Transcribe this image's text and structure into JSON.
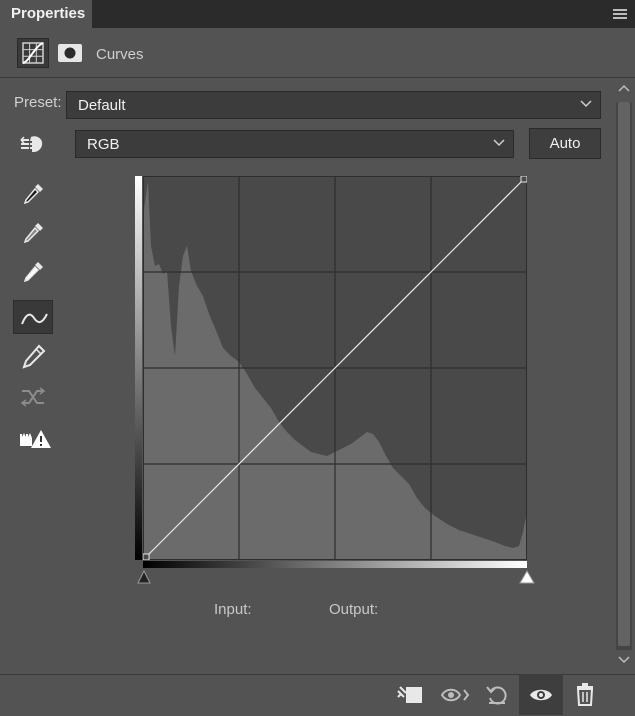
{
  "panel": {
    "tab_label": "Properties",
    "adjustment_name": "Curves"
  },
  "preset": {
    "label": "Preset:",
    "value": "Default"
  },
  "channel": {
    "value": "RGB"
  },
  "auto_label": "Auto",
  "tools": [
    "on-image-adjust-icon",
    "black-point-eyedropper-icon",
    "gray-point-eyedropper-icon",
    "white-point-eyedropper-icon",
    "edit-points-curve-icon",
    "draw-pencil-icon",
    "smooth-curve-icon",
    "clipping-warning-icon"
  ],
  "curve": {
    "points": [
      [
        0,
        0
      ],
      [
        255,
        255
      ]
    ]
  },
  "io": {
    "input_label": "Input:",
    "output_label": "Output:"
  },
  "footer_icons": [
    "clip-to-layer-icon",
    "view-previous-state-icon",
    "reset-icon",
    "visibility-eye-icon",
    "trash-icon"
  ],
  "colors": {
    "panel_bg": "#535353",
    "graph_bg": "#494949",
    "histogram": "#6b6b6b",
    "tab_bar": "#2b2b2b"
  }
}
